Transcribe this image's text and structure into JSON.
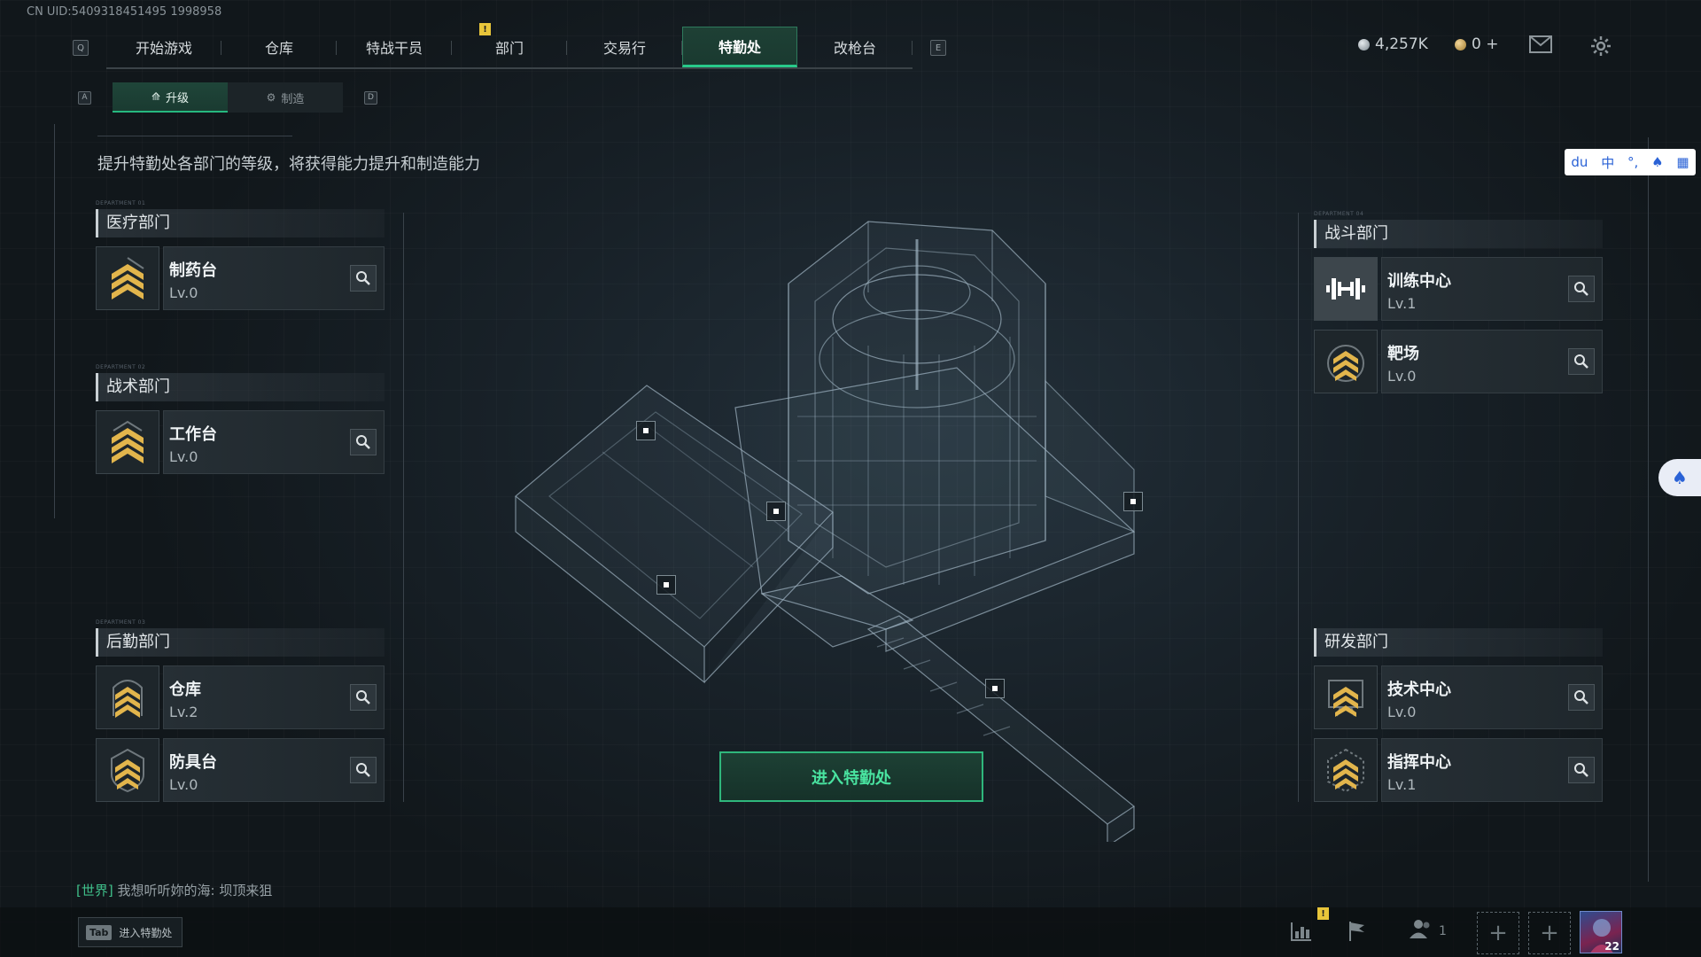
{
  "uid": "CN UID:5409318451495 1998958",
  "nav": {
    "left_key": "Q",
    "right_key": "E",
    "tabs": [
      "开始游戏",
      "仓库",
      "特战干员",
      "部门",
      "交易行",
      "特勤处",
      "改枪台"
    ],
    "active": "特勤处",
    "alert_mark": "!"
  },
  "currency": {
    "silver": "4,257K",
    "gold": "0 +"
  },
  "subnav": {
    "left_key": "A",
    "right_key": "D",
    "upgrade": "升级",
    "craft": "制造"
  },
  "description": "提升特勤处各部门的等级，将获得能力提升和制造能力",
  "departments": {
    "medical": {
      "micro": "DEPARTMENT 01",
      "name": "医疗部门",
      "facilities": [
        {
          "name": "制药台",
          "level": "Lv.0"
        }
      ]
    },
    "tactical": {
      "micro": "DEPARTMENT 02",
      "name": "战术部门",
      "facilities": [
        {
          "name": "工作台",
          "level": "Lv.0"
        }
      ]
    },
    "logistics": {
      "micro": "DEPARTMENT 03",
      "name": "后勤部门",
      "facilities": [
        {
          "name": "仓库",
          "level": "Lv.2"
        },
        {
          "name": "防具台",
          "level": "Lv.0"
        }
      ]
    },
    "combat": {
      "micro": "DEPARTMENT 04",
      "name": "战斗部门",
      "facilities": [
        {
          "name": "训练中心",
          "level": "Lv.1"
        },
        {
          "name": "靶场",
          "level": "Lv.0"
        }
      ]
    },
    "research": {
      "micro": "",
      "name": "研发部门",
      "facilities": [
        {
          "name": "技术中心",
          "level": "Lv.0"
        },
        {
          "name": "指挥中心",
          "level": "Lv.1"
        }
      ]
    }
  },
  "enter_button": "进入特勤处",
  "chat": {
    "channel": "[世界]",
    "message": "我想听听妳的海: 坝顶来狙"
  },
  "tab_hint": {
    "key": "Tab",
    "label": "进入特勤处"
  },
  "bottom": {
    "friends_count": "1",
    "player_level": "22",
    "alert_mark": "!"
  },
  "ime": {
    "mode": "中"
  },
  "colors": {
    "accent": "#28c98a",
    "warning": "#e8c53a",
    "panel": "#262f35"
  }
}
